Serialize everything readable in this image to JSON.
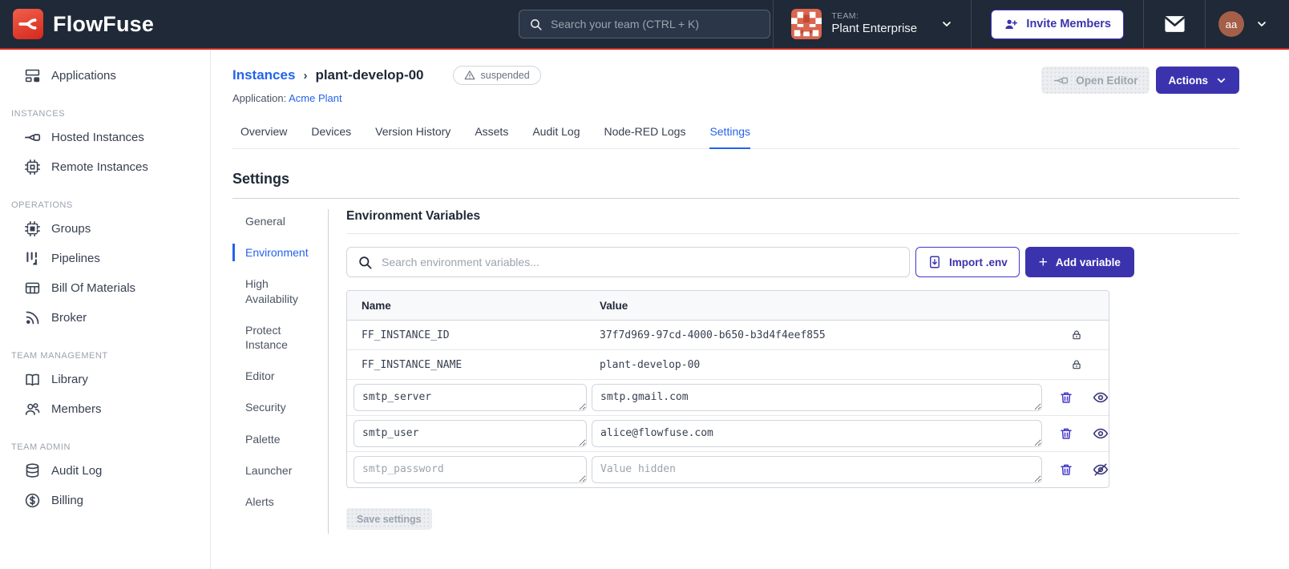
{
  "navbar": {
    "brand": "FlowFuse",
    "search_placeholder": "Search your team (CTRL + K)",
    "team_label": "TEAM:",
    "team_name": "Plant Enterprise",
    "invite_button": "Invite Members",
    "user_initials": "aa"
  },
  "sidebar": {
    "top_item": {
      "label": "Applications",
      "icon": "applications-icon"
    },
    "sections": [
      {
        "header": "INSTANCES",
        "items": [
          {
            "label": "Hosted Instances",
            "icon": "hosted-instances-icon"
          },
          {
            "label": "Remote Instances",
            "icon": "remote-instances-icon"
          }
        ]
      },
      {
        "header": "OPERATIONS",
        "items": [
          {
            "label": "Groups",
            "icon": "groups-icon"
          },
          {
            "label": "Pipelines",
            "icon": "pipelines-icon"
          },
          {
            "label": "Bill Of Materials",
            "icon": "bill-of-materials-icon"
          },
          {
            "label": "Broker",
            "icon": "broker-icon"
          }
        ]
      },
      {
        "header": "TEAM MANAGEMENT",
        "items": [
          {
            "label": "Library",
            "icon": "library-icon"
          },
          {
            "label": "Members",
            "icon": "members-icon"
          }
        ]
      },
      {
        "header": "TEAM ADMIN",
        "items": [
          {
            "label": "Audit Log",
            "icon": "audit-log-icon"
          },
          {
            "label": "Billing",
            "icon": "billing-icon"
          }
        ]
      }
    ]
  },
  "header": {
    "breadcrumb_parent": "Instances",
    "breadcrumb_separator": "›",
    "breadcrumb_current": "plant-develop-00",
    "status_badge": "suspended",
    "application_label": "Application:",
    "application_name": "Acme Plant",
    "open_editor_button": "Open Editor",
    "actions_button": "Actions"
  },
  "tabs": [
    {
      "label": "Overview"
    },
    {
      "label": "Devices"
    },
    {
      "label": "Version History"
    },
    {
      "label": "Assets"
    },
    {
      "label": "Audit Log"
    },
    {
      "label": "Node-RED Logs"
    },
    {
      "label": "Settings",
      "active": true
    }
  ],
  "settings": {
    "title": "Settings",
    "nav": [
      {
        "label": "General"
      },
      {
        "label": "Environment",
        "active": true
      },
      {
        "label": "High Availability"
      },
      {
        "label": "Protect Instance"
      },
      {
        "label": "Editor"
      },
      {
        "label": "Security"
      },
      {
        "label": "Palette"
      },
      {
        "label": "Launcher"
      },
      {
        "label": "Alerts"
      }
    ],
    "env": {
      "title": "Environment Variables",
      "search_placeholder": "Search environment variables...",
      "import_button": "Import .env",
      "add_button": "Add variable",
      "save_button": "Save settings",
      "table": {
        "columns": {
          "name": "Name",
          "value": "Value"
        },
        "locked_rows": [
          {
            "name": "FF_INSTANCE_ID",
            "value": "37f7d969-97cd-4000-b650-b3d4f4eef855"
          },
          {
            "name": "FF_INSTANCE_NAME",
            "value": "plant-develop-00"
          }
        ],
        "editable_rows": [
          {
            "name": "smtp_server",
            "value": "smtp.gmail.com"
          },
          {
            "name": "smtp_user",
            "value": "alice@flowfuse.com"
          },
          {
            "name": "smtp_password",
            "value": "",
            "value_placeholder": "Value hidden",
            "hidden": true
          }
        ]
      }
    }
  },
  "colors": {
    "navbar_bg": "#1F2937",
    "brand_red": "#CE2B26",
    "accent_indigo": "#3B33AE",
    "link_blue": "#2563EB",
    "disabled_text": "#9CA3AF"
  }
}
